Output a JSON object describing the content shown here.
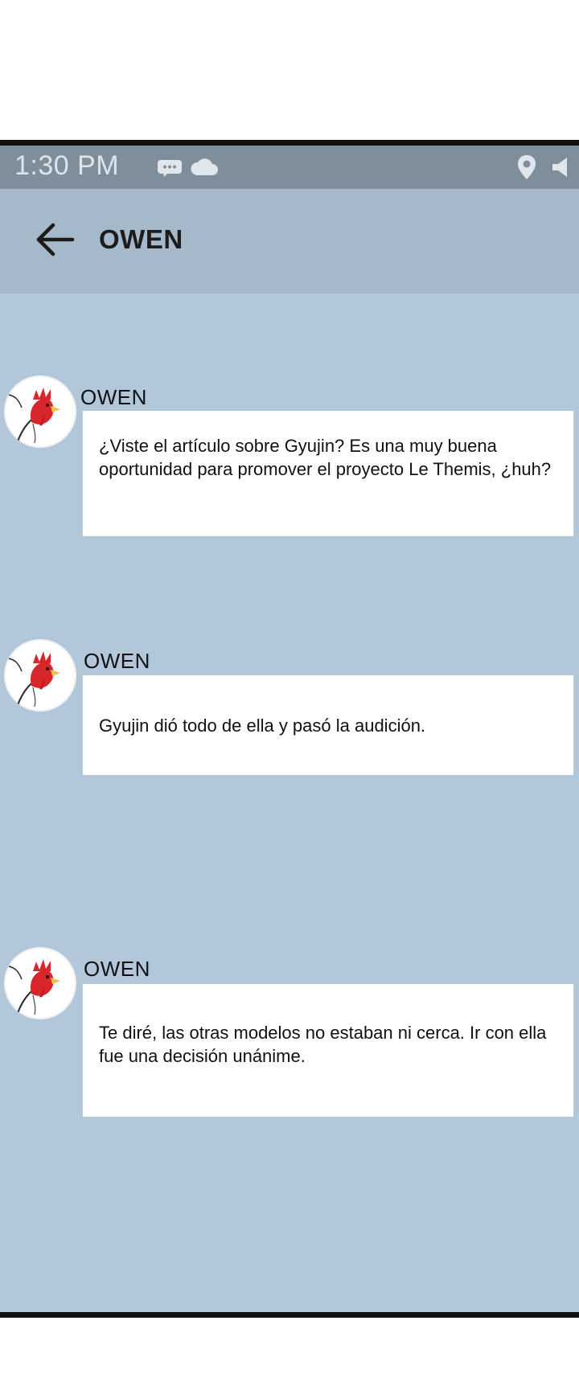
{
  "status_bar": {
    "time": "1:30 PM",
    "icons": [
      "message-icon",
      "cloud-icon",
      "location-icon",
      "volume-icon"
    ]
  },
  "app_bar": {
    "back_icon": "arrow-left-icon",
    "title": "OWEN"
  },
  "colors": {
    "chat_background": "#b2c7d9",
    "status_bar": "#7f8e9b",
    "app_bar": "#a5b9ca",
    "bubble": "#ffffff"
  },
  "messages": [
    {
      "avatar_icon": "rooster-icon",
      "sender": "OWEN",
      "text": "¿Viste el artículo sobre Gyujin? Es una muy buena oportunidad para promover el proyecto Le Themis, ¿huh?"
    },
    {
      "avatar_icon": "rooster-icon",
      "sender": "OWEN",
      "text": "Gyujin dió todo de ella y pasó la audición."
    },
    {
      "avatar_icon": "rooster-icon",
      "sender": "OWEN",
      "text": "Te diré, las otras modelos no estaban ni cerca. Ir con ella fue una decisión unánime."
    }
  ]
}
